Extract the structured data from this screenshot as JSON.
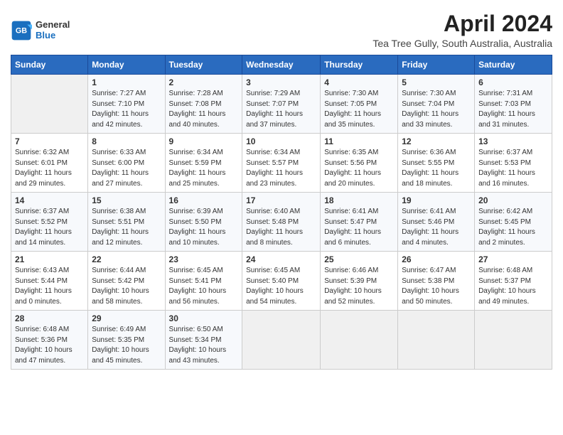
{
  "header": {
    "logo": {
      "general": "General",
      "blue": "Blue"
    },
    "title": "April 2024",
    "subtitle": "Tea Tree Gully, South Australia, Australia"
  },
  "calendar": {
    "days_of_week": [
      "Sunday",
      "Monday",
      "Tuesday",
      "Wednesday",
      "Thursday",
      "Friday",
      "Saturday"
    ],
    "weeks": [
      [
        {
          "num": "",
          "info": ""
        },
        {
          "num": "1",
          "info": "Sunrise: 7:27 AM\nSunset: 7:10 PM\nDaylight: 11 hours\nand 42 minutes."
        },
        {
          "num": "2",
          "info": "Sunrise: 7:28 AM\nSunset: 7:08 PM\nDaylight: 11 hours\nand 40 minutes."
        },
        {
          "num": "3",
          "info": "Sunrise: 7:29 AM\nSunset: 7:07 PM\nDaylight: 11 hours\nand 37 minutes."
        },
        {
          "num": "4",
          "info": "Sunrise: 7:30 AM\nSunset: 7:05 PM\nDaylight: 11 hours\nand 35 minutes."
        },
        {
          "num": "5",
          "info": "Sunrise: 7:30 AM\nSunset: 7:04 PM\nDaylight: 11 hours\nand 33 minutes."
        },
        {
          "num": "6",
          "info": "Sunrise: 7:31 AM\nSunset: 7:03 PM\nDaylight: 11 hours\nand 31 minutes."
        }
      ],
      [
        {
          "num": "7",
          "info": "Sunrise: 6:32 AM\nSunset: 6:01 PM\nDaylight: 11 hours\nand 29 minutes."
        },
        {
          "num": "8",
          "info": "Sunrise: 6:33 AM\nSunset: 6:00 PM\nDaylight: 11 hours\nand 27 minutes."
        },
        {
          "num": "9",
          "info": "Sunrise: 6:34 AM\nSunset: 5:59 PM\nDaylight: 11 hours\nand 25 minutes."
        },
        {
          "num": "10",
          "info": "Sunrise: 6:34 AM\nSunset: 5:57 PM\nDaylight: 11 hours\nand 23 minutes."
        },
        {
          "num": "11",
          "info": "Sunrise: 6:35 AM\nSunset: 5:56 PM\nDaylight: 11 hours\nand 20 minutes."
        },
        {
          "num": "12",
          "info": "Sunrise: 6:36 AM\nSunset: 5:55 PM\nDaylight: 11 hours\nand 18 minutes."
        },
        {
          "num": "13",
          "info": "Sunrise: 6:37 AM\nSunset: 5:53 PM\nDaylight: 11 hours\nand 16 minutes."
        }
      ],
      [
        {
          "num": "14",
          "info": "Sunrise: 6:37 AM\nSunset: 5:52 PM\nDaylight: 11 hours\nand 14 minutes."
        },
        {
          "num": "15",
          "info": "Sunrise: 6:38 AM\nSunset: 5:51 PM\nDaylight: 11 hours\nand 12 minutes."
        },
        {
          "num": "16",
          "info": "Sunrise: 6:39 AM\nSunset: 5:50 PM\nDaylight: 11 hours\nand 10 minutes."
        },
        {
          "num": "17",
          "info": "Sunrise: 6:40 AM\nSunset: 5:48 PM\nDaylight: 11 hours\nand 8 minutes."
        },
        {
          "num": "18",
          "info": "Sunrise: 6:41 AM\nSunset: 5:47 PM\nDaylight: 11 hours\nand 6 minutes."
        },
        {
          "num": "19",
          "info": "Sunrise: 6:41 AM\nSunset: 5:46 PM\nDaylight: 11 hours\nand 4 minutes."
        },
        {
          "num": "20",
          "info": "Sunrise: 6:42 AM\nSunset: 5:45 PM\nDaylight: 11 hours\nand 2 minutes."
        }
      ],
      [
        {
          "num": "21",
          "info": "Sunrise: 6:43 AM\nSunset: 5:44 PM\nDaylight: 11 hours\nand 0 minutes."
        },
        {
          "num": "22",
          "info": "Sunrise: 6:44 AM\nSunset: 5:42 PM\nDaylight: 10 hours\nand 58 minutes."
        },
        {
          "num": "23",
          "info": "Sunrise: 6:45 AM\nSunset: 5:41 PM\nDaylight: 10 hours\nand 56 minutes."
        },
        {
          "num": "24",
          "info": "Sunrise: 6:45 AM\nSunset: 5:40 PM\nDaylight: 10 hours\nand 54 minutes."
        },
        {
          "num": "25",
          "info": "Sunrise: 6:46 AM\nSunset: 5:39 PM\nDaylight: 10 hours\nand 52 minutes."
        },
        {
          "num": "26",
          "info": "Sunrise: 6:47 AM\nSunset: 5:38 PM\nDaylight: 10 hours\nand 50 minutes."
        },
        {
          "num": "27",
          "info": "Sunrise: 6:48 AM\nSunset: 5:37 PM\nDaylight: 10 hours\nand 49 minutes."
        }
      ],
      [
        {
          "num": "28",
          "info": "Sunrise: 6:48 AM\nSunset: 5:36 PM\nDaylight: 10 hours\nand 47 minutes."
        },
        {
          "num": "29",
          "info": "Sunrise: 6:49 AM\nSunset: 5:35 PM\nDaylight: 10 hours\nand 45 minutes."
        },
        {
          "num": "30",
          "info": "Sunrise: 6:50 AM\nSunset: 5:34 PM\nDaylight: 10 hours\nand 43 minutes."
        },
        {
          "num": "",
          "info": ""
        },
        {
          "num": "",
          "info": ""
        },
        {
          "num": "",
          "info": ""
        },
        {
          "num": "",
          "info": ""
        }
      ]
    ]
  }
}
